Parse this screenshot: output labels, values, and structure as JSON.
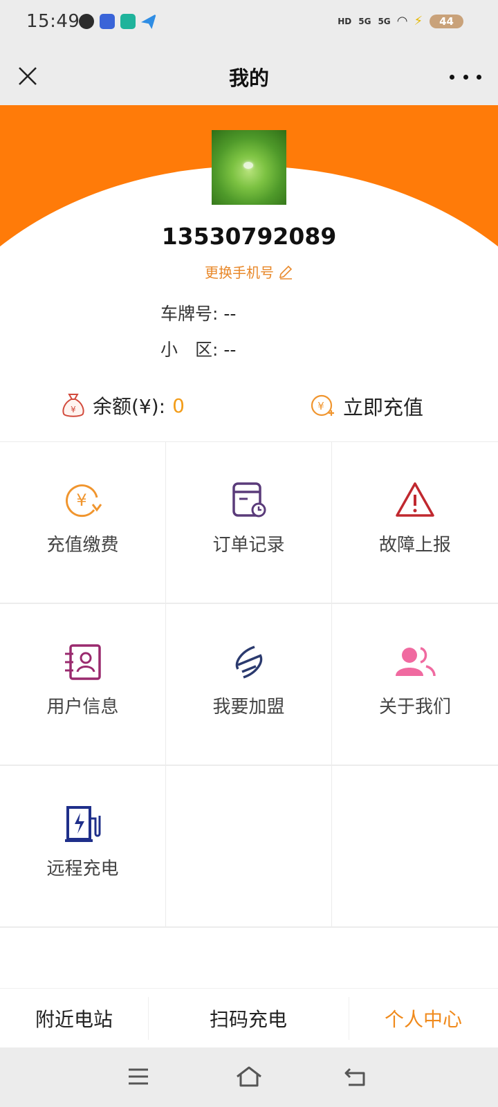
{
  "status_bar": {
    "time": "15:49",
    "battery": "44",
    "network_1": "5G",
    "network_2": "5G",
    "hd_label": "HD"
  },
  "header": {
    "title": "我的",
    "close_icon": "close-icon",
    "more_icon": "more-icon"
  },
  "profile": {
    "phone": "13530792089",
    "change_phone_label": "更换手机号",
    "plate_label": "车牌号:",
    "plate_value": "--",
    "area_label": "小　区:",
    "area_value": "--"
  },
  "balance": {
    "label": "余额(¥):",
    "value": "0",
    "recharge_label": "立即充值"
  },
  "menu": [
    {
      "label": "充值缴费",
      "icon": "yen-refresh-icon",
      "color": "#f0952e"
    },
    {
      "label": "订单记录",
      "icon": "order-record-icon",
      "color": "#5a3b7a"
    },
    {
      "label": "故障上报",
      "icon": "warning-icon",
      "color": "#c0282f"
    },
    {
      "label": "用户信息",
      "icon": "user-card-icon",
      "color": "#9a2a6e"
    },
    {
      "label": "我要加盟",
      "icon": "join-icon",
      "color": "#2b3a6e"
    },
    {
      "label": "关于我们",
      "icon": "users-icon",
      "color": "#f06aa0"
    },
    {
      "label": "远程充电",
      "icon": "charging-station-icon",
      "color": "#1f2f8a"
    }
  ],
  "tabs": [
    {
      "label": "附近电站",
      "active": false
    },
    {
      "label": "扫码充电",
      "active": false
    },
    {
      "label": "个人中心",
      "active": true
    }
  ],
  "colors": {
    "brand_orange": "#ff7b09",
    "accent_orange": "#f08a1c"
  }
}
